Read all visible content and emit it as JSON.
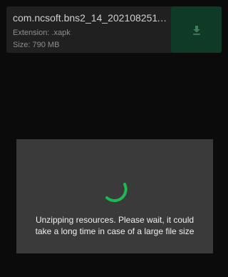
{
  "file": {
    "name": "com.ncsoft.bns2_14_202108251144...",
    "extension_label": "Extension: .xapk",
    "size_label": "Size: 790 MB",
    "download_icon": "download-icon"
  },
  "modal": {
    "spinner_icon": "loading-spinner-icon",
    "message_line1": "Unzipping resources. Please wait, it could",
    "message_line2": "take a long time in case of a large file size"
  },
  "colors": {
    "background": "#0b0b0b",
    "card": "#202020",
    "download_button": "#0f3a26",
    "accent_green": "#1db954",
    "modal": "#3a3a3a"
  }
}
